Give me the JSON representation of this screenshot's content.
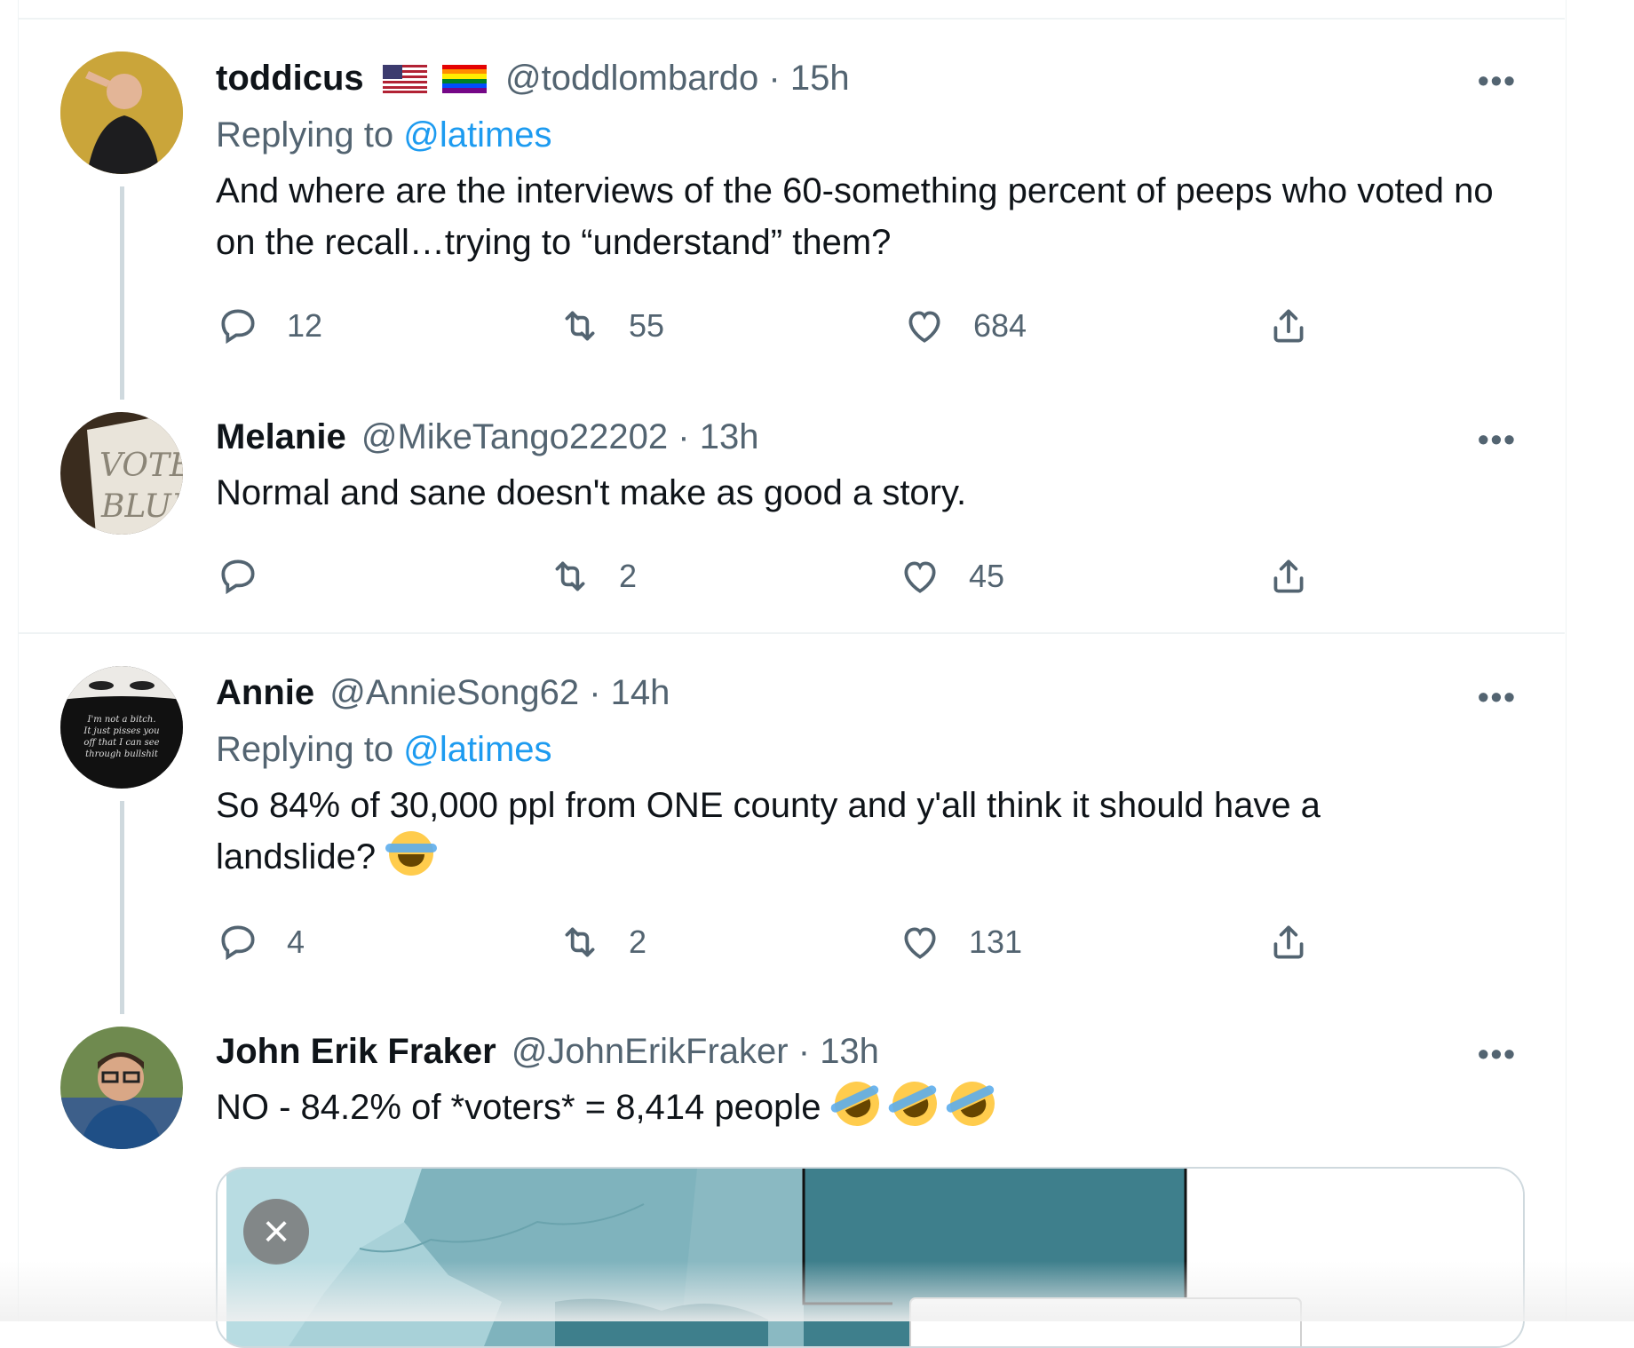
{
  "tweets": [
    {
      "name": "toddicus",
      "handle": "@toddlombardo",
      "dot": "·",
      "time": "15h",
      "replying_label": "Replying to",
      "replying_to": "@latimes",
      "text": "And where are the interviews of the 60-something percent of peeps who voted no on the recall…trying to “understand” them?",
      "more": "•••",
      "replies": "12",
      "retweets": "55",
      "likes": "684"
    },
    {
      "name": "Melanie",
      "handle": "@MikeTango22202",
      "dot": "·",
      "time": "13h",
      "text": "Normal and sane doesn't make as good a story.",
      "more": "•••",
      "replies": "",
      "retweets": "2",
      "likes": "45"
    },
    {
      "name": "Annie",
      "handle": "@AnnieSong62",
      "dot": "·",
      "time": "14h",
      "replying_label": "Replying to",
      "replying_to": "@latimes",
      "text_line1": "So 84% of 30,000 ppl from ONE county and y'all think it should have a",
      "text_line2": "landslide?",
      "avatar_text": "I'm not a bitch. It just pisses you off that I can see through bullshit",
      "more": "•••",
      "replies": "4",
      "retweets": "2",
      "likes": "131"
    },
    {
      "name": "John Erik Fraker",
      "handle": "@JohnErikFraker",
      "dot": "·",
      "time": "13h",
      "text": "NO - 84.2% of *voters* = 8,414 people",
      "more": "•••"
    }
  ],
  "media": {
    "close_label": "×"
  },
  "icons": {
    "reply": "reply-icon",
    "retweet": "retweet-icon",
    "like": "heart-icon",
    "share": "share-icon",
    "emoji_laugh": "tears-of-joy-emoji",
    "emoji_rofl": "rolling-on-floor-laughing-emoji"
  },
  "colors": {
    "link": "#1d9bf0",
    "secondary_text": "#536471",
    "primary_text": "#0f1419",
    "divider": "#eff3f4",
    "thread_line": "#cfd9de"
  }
}
